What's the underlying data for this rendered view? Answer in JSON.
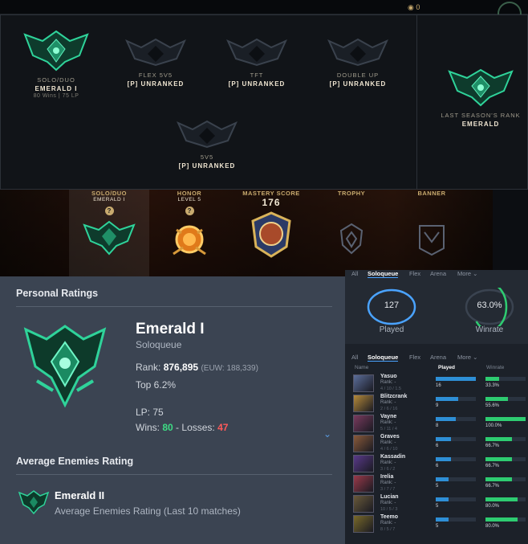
{
  "colors": {
    "emerald": "#2fd39a",
    "accent_blue": "#4aa3ff",
    "win_green": "#3ddc84",
    "loss_red": "#ff5a5a",
    "gold": "#c8aa6e"
  },
  "top_strip": {
    "currency": "0"
  },
  "ranked": {
    "queues": [
      {
        "queue": "SOLO/DUO",
        "tier": "EMERALD I",
        "sub": "80 Wins | 75 LP",
        "icon": "emerald-crest-icon"
      },
      {
        "queue": "FLEX 5V5",
        "tier": "[P] UNRANKED",
        "sub": "",
        "icon": "unranked-crest-icon"
      },
      {
        "queue": "TFT",
        "tier": "[P] UNRANKED",
        "sub": "",
        "icon": "unranked-crest-icon"
      },
      {
        "queue": "DOUBLE UP",
        "tier": "[P] UNRANKED",
        "sub": "",
        "icon": "unranked-crest-icon"
      },
      {
        "queue": "5V5",
        "tier": "[P] UNRANKED",
        "sub": "",
        "icon": "unranked-crest-icon"
      }
    ],
    "last_season": {
      "label": "LAST SEASON'S RANK",
      "tier": "EMERALD"
    }
  },
  "banner": {
    "solo": {
      "label": "SOLO/DUO",
      "sub": "EMERALD I"
    },
    "honor": {
      "label": "HONOR",
      "sub": "LEVEL 5"
    },
    "mastery": {
      "label": "MASTERY SCORE",
      "value": "176"
    },
    "trophy": {
      "label": "TROPHY"
    },
    "banner": {
      "label": "BANNER"
    },
    "qmark": "?"
  },
  "personal": {
    "heading": "Personal Ratings",
    "tier": "Emerald I",
    "queue": "Soloqueue",
    "rank_label": "Rank:",
    "rank_value": "876,895",
    "rank_region": "(EUW: 188,339)",
    "top": "Top 6.2%",
    "lp": "LP: 75",
    "wins_label": "Wins:",
    "wins": "80",
    "sep": "-",
    "losses_label": "Losses:",
    "losses": "47",
    "avg_heading": "Average Enemies Rating",
    "avg_tier": "Emerald II",
    "avg_sub": "Average Enemies Rating (Last 10 matches)"
  },
  "stats": {
    "tabs": [
      "All",
      "Soloqueue",
      "Flex",
      "Arena",
      "More ⌄"
    ],
    "played": {
      "value": "127",
      "label": "Played"
    },
    "winrate": {
      "value": "63.0%",
      "label": "Winrate",
      "fraction": 0.63
    },
    "columns": {
      "name": "Name",
      "played": "Played",
      "winrate": "Winrate"
    },
    "rows": [
      {
        "name": "Yasuo",
        "rank": "Rank: -",
        "kda": "4 / 10 / 1.5",
        "played": "16",
        "played_frac": 1.0,
        "winrate": "33.3%",
        "win_frac": 0.333,
        "color": "#5b6e9a"
      },
      {
        "name": "Blitzcrank",
        "rank": "Rank: -",
        "kda": "2 / 6 / 16",
        "played": "9",
        "played_frac": 0.56,
        "winrate": "55.6%",
        "win_frac": 0.556,
        "color": "#b58a3a"
      },
      {
        "name": "Vayne",
        "rank": "Rank: -",
        "kda": "5 / 11 / 4",
        "played": "8",
        "played_frac": 0.5,
        "winrate": "100.0%",
        "win_frac": 1.0,
        "color": "#7a3b5e"
      },
      {
        "name": "Graves",
        "rank": "Rank: -",
        "kda": "4 / 6 / 10",
        "played": "6",
        "played_frac": 0.38,
        "winrate": "66.7%",
        "win_frac": 0.667,
        "color": "#8a5a3a"
      },
      {
        "name": "Kassadin",
        "rank": "Rank: -",
        "kda": "3 / 6 / 2",
        "played": "6",
        "played_frac": 0.38,
        "winrate": "66.7%",
        "win_frac": 0.667,
        "color": "#5a3a8a"
      },
      {
        "name": "Irelia",
        "rank": "Rank: -",
        "kda": "3 / 7 / 7",
        "played": "5",
        "played_frac": 0.31,
        "winrate": "66.7%",
        "win_frac": 0.667,
        "color": "#9a3a4a"
      },
      {
        "name": "Lucian",
        "rank": "Rank: -",
        "kda": "10 / 5 / 3",
        "played": "5",
        "played_frac": 0.31,
        "winrate": "80.0%",
        "win_frac": 0.8,
        "color": "#6a5a3a"
      },
      {
        "name": "Teemo",
        "rank": "Rank: -",
        "kda": "8 / 5 / 7",
        "played": "5",
        "played_frac": 0.31,
        "winrate": "80.0%",
        "win_frac": 0.8,
        "color": "#7a6a2a"
      }
    ]
  }
}
